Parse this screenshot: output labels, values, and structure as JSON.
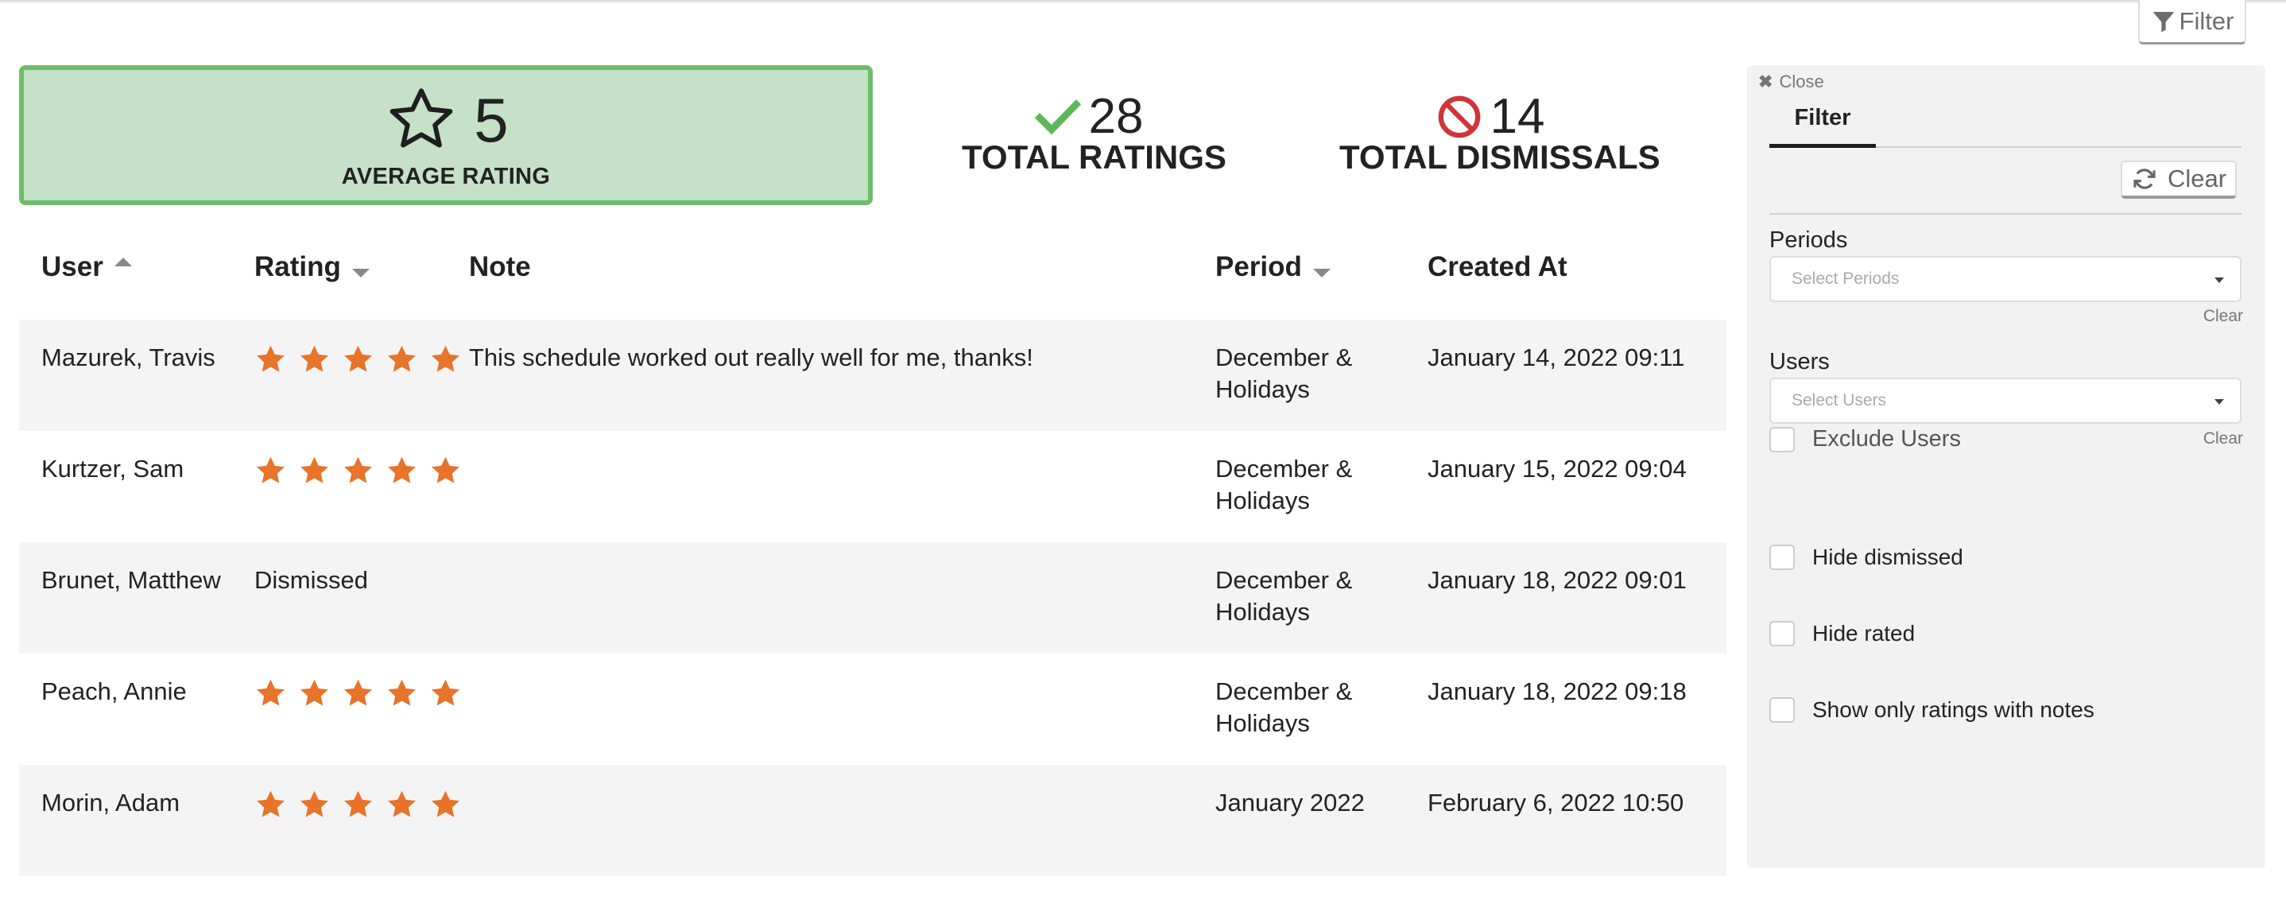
{
  "toolbar": {
    "filter_label": "Filter"
  },
  "summary": {
    "average": {
      "value": "5",
      "label": "AVERAGE RATING"
    },
    "total_ratings": {
      "value": "28",
      "label": "TOTAL RATINGS"
    },
    "total_dismissals": {
      "value": "14",
      "label": "TOTAL DISMISSALS"
    }
  },
  "table": {
    "headers": {
      "user": "User",
      "rating": "Rating",
      "note": "Note",
      "period": "Period",
      "created_at": "Created At"
    },
    "rows": [
      {
        "user": "Mazurek, Travis",
        "rating": 5,
        "rating_text": "",
        "note": "This schedule worked out really well for me, thanks!",
        "period": "December & Holidays",
        "created_at": "January 14, 2022 09:11"
      },
      {
        "user": "Kurtzer, Sam",
        "rating": 5,
        "rating_text": "",
        "note": "",
        "period": "December & Holidays",
        "created_at": "January 15, 2022 09:04"
      },
      {
        "user": "Brunet, Matthew",
        "rating": 0,
        "rating_text": "Dismissed",
        "note": "",
        "period": "December & Holidays",
        "created_at": "January 18, 2022 09:01"
      },
      {
        "user": "Peach, Annie",
        "rating": 5,
        "rating_text": "",
        "note": "",
        "period": "December & Holidays",
        "created_at": "January 18, 2022 09:18"
      },
      {
        "user": "Morin, Adam",
        "rating": 5,
        "rating_text": "",
        "note": "",
        "period": "January 2022",
        "created_at": "February 6, 2022 10:50"
      }
    ]
  },
  "sidebar": {
    "close_label": "Close",
    "tab_label": "Filter",
    "clear_label": "Clear",
    "periods": {
      "label": "Periods",
      "placeholder": "Select Periods",
      "clear": "Clear"
    },
    "users": {
      "label": "Users",
      "placeholder": "Select Users",
      "clear": "Clear",
      "exclude_label": "Exclude Users"
    },
    "options": {
      "hide_dismissed": "Hide dismissed",
      "hide_rated": "Hide rated",
      "show_notes": "Show only ratings with notes"
    }
  },
  "colors": {
    "star": "#e8732a",
    "card_bg": "#c5e1c8",
    "card_border": "#6dbd6a",
    "check": "#5cb85c",
    "ban": "#d0343a"
  },
  "icons": [
    "filter-icon",
    "star-outline-icon",
    "check-icon",
    "ban-icon",
    "star-icon",
    "close-icon",
    "refresh-icon",
    "dropdown-caret-icon"
  ]
}
